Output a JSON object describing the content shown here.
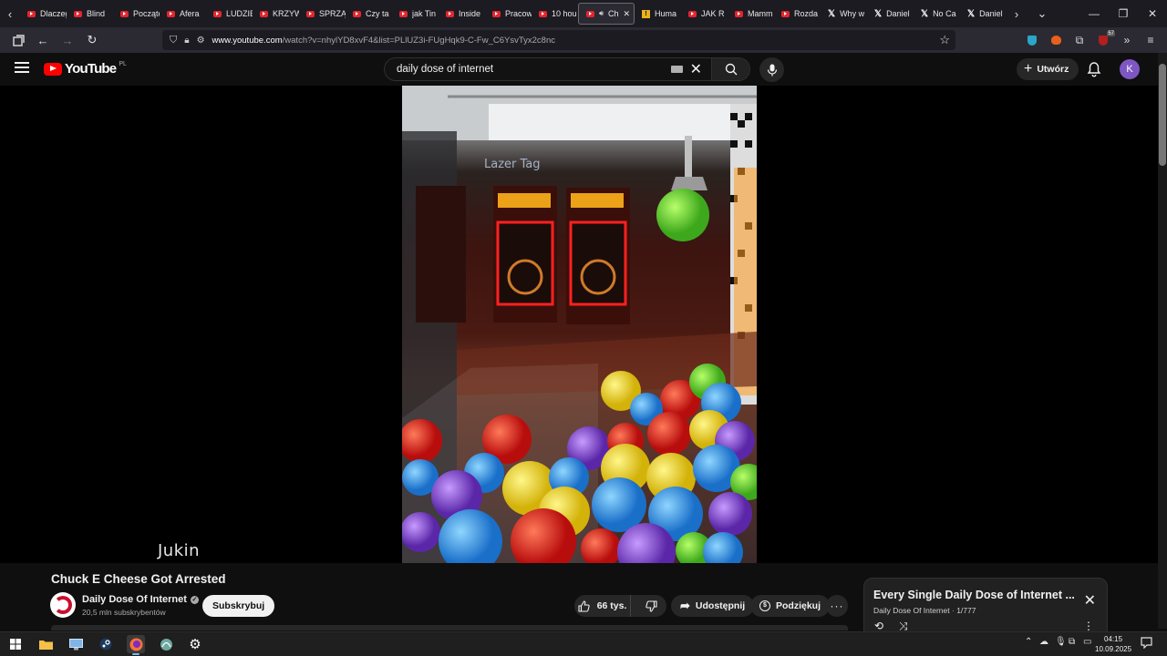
{
  "browser": {
    "tabs": [
      {
        "label": "Dlaczego",
        "icon": "youtube"
      },
      {
        "label": "Blind",
        "icon": "youtube"
      },
      {
        "label": "Początek",
        "icon": "youtube"
      },
      {
        "label": "Afera",
        "icon": "youtube"
      },
      {
        "label": "LUDZIE",
        "icon": "youtube"
      },
      {
        "label": "KRZYW",
        "icon": "youtube"
      },
      {
        "label": "SPRZĄ",
        "icon": "youtube"
      },
      {
        "label": "Czy ta",
        "icon": "youtube"
      },
      {
        "label": "jak Tin",
        "icon": "youtube"
      },
      {
        "label": "Inside",
        "icon": "youtube"
      },
      {
        "label": "Pracow",
        "icon": "youtube"
      },
      {
        "label": "10 hou",
        "icon": "youtube"
      },
      {
        "label": "Chu",
        "icon": "youtube",
        "active": true
      },
      {
        "label": "Huma",
        "icon": "warning"
      },
      {
        "label": "JAK R",
        "icon": "youtube"
      },
      {
        "label": "Mamm",
        "icon": "youtube"
      },
      {
        "label": "Rozda",
        "icon": "youtube"
      },
      {
        "label": "Why w",
        "icon": "x"
      },
      {
        "label": "Daniel",
        "icon": "x"
      },
      {
        "label": "No Ca",
        "icon": "x"
      },
      {
        "label": "Daniel",
        "icon": "x"
      }
    ],
    "url_host": "www.youtube.com",
    "url_path": "/watch?v=nhylYD8xvF4&list=PLlUZ3i-FUgHqk9-C-Fw_C6YsvTyx2c8nc",
    "notification_count": "57"
  },
  "youtube": {
    "logo_text": "YouTube",
    "region": "PL",
    "search_value": "daily dose of internet",
    "create_label": "Utwórz",
    "avatar_letter": "K"
  },
  "video": {
    "watermark": "Jukin",
    "title": "Chuck E Cheese Got Arrested",
    "channel_name": "Daily Dose Of Internet",
    "subscribers": "20,5 mln subskrybentów",
    "subscribe_label": "Subskrybuj",
    "likes": "66 tys.",
    "share_label": "Udostępnij",
    "thanks_label": "Podziękuj"
  },
  "playlist": {
    "title": "Every Single Daily Dose of Internet ...",
    "channel": "Daily Dose Of Internet",
    "position": "1/777"
  },
  "taskbar": {
    "time": "04:15",
    "date": "10.09.2025"
  },
  "colors": {
    "brand_red": "#ff0000",
    "background": "#0f0f0f",
    "avatar": "#7e57c2"
  }
}
